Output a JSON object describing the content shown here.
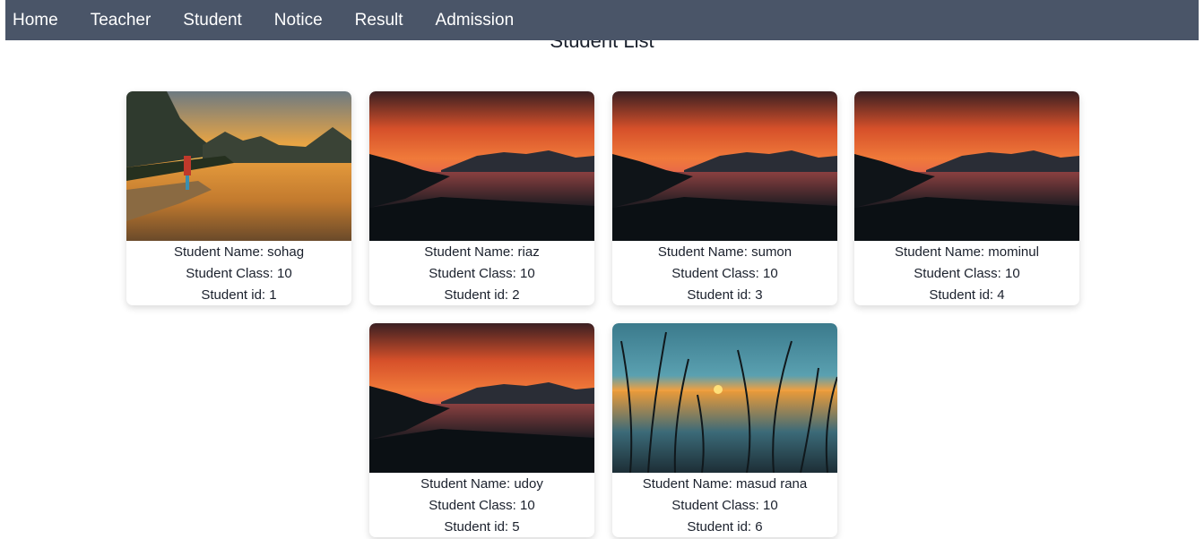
{
  "nav": {
    "items": [
      {
        "label": "Home"
      },
      {
        "label": "Teacher"
      },
      {
        "label": "Student"
      },
      {
        "label": "Notice"
      },
      {
        "label": "Result"
      },
      {
        "label": "Admission"
      }
    ]
  },
  "page": {
    "title": "Student List"
  },
  "students": [
    {
      "name": "Student Name: sohag",
      "class": "Student Class: 10",
      "id": "Student id: 1",
      "image": "lake-dock-sunset"
    },
    {
      "name": "Student Name: riaz",
      "class": "Student Class: 10",
      "id": "Student id: 2",
      "image": "mountain-lake-sunset"
    },
    {
      "name": "Student Name: sumon",
      "class": "Student Class: 10",
      "id": "Student id: 3",
      "image": "mountain-lake-sunset"
    },
    {
      "name": "Student Name: mominul",
      "class": "Student Class: 10",
      "id": "Student id: 4",
      "image": "mountain-lake-sunset"
    },
    {
      "name": "Student Name: udoy",
      "class": "Student Class: 10",
      "id": "Student id: 5",
      "image": "mountain-lake-sunset"
    },
    {
      "name": "Student Name: masud rana",
      "class": "Student Class: 10",
      "id": "Student id: 6",
      "image": "reeds-sunset"
    }
  ]
}
